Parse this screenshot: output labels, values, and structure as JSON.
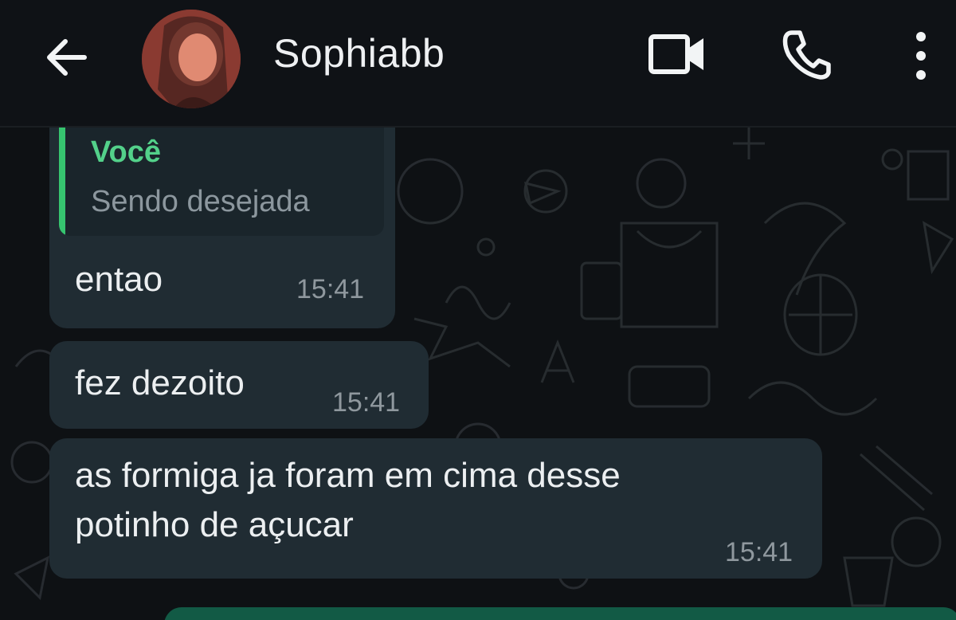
{
  "header": {
    "contact_name": "Sophiabb",
    "back_icon": "arrow-left-icon",
    "video_icon": "video-camera-icon",
    "call_icon": "phone-icon",
    "more_icon": "vertical-dots-icon"
  },
  "messages": [
    {
      "direction": "incoming",
      "quote": {
        "author": "Você",
        "text": "Sendo desejada"
      },
      "text": "entao",
      "time": "15:41"
    },
    {
      "direction": "incoming",
      "text": "fez dezoito",
      "time": "15:41"
    },
    {
      "direction": "incoming",
      "lines": [
        "as formiga ja foram em cima desse",
        "potinho de açucar"
      ],
      "time": "15:41"
    }
  ],
  "colors": {
    "header_bg": "#0f1216",
    "chat_bg": "#0e1114",
    "incoming_bubble": "#202c33",
    "outgoing_bubble": "#125a45",
    "quote_accent": "#36c46f"
  }
}
